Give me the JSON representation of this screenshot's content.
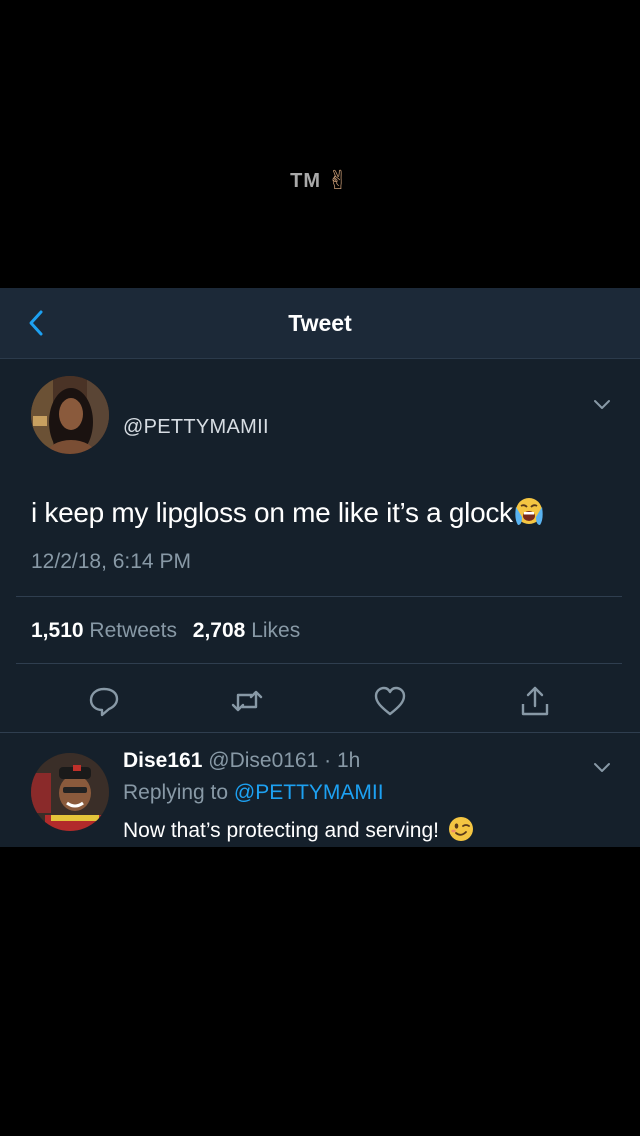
{
  "watermark": {
    "text": "TM",
    "emoji": "✌"
  },
  "navbar": {
    "title": "Tweet",
    "back_icon": "chevron-left-icon"
  },
  "tweet": {
    "handle": "@PETTYMAMII",
    "text": "i keep my lipgloss on me like it’s a glock",
    "emoji": "loudly-crying-face",
    "timestamp": "12/2/18, 6:14 PM",
    "retweets_count": "1,510",
    "retweets_label": "Retweets",
    "likes_count": "2,708",
    "likes_label": "Likes",
    "actions": [
      "reply-icon",
      "retweet-icon",
      "like-icon",
      "share-icon"
    ]
  },
  "reply": {
    "name": "Dise161",
    "meta": "@Dise0161 · 1h",
    "replying_prefix": "Replying to",
    "replying_to": "@PETTYMAMII",
    "text": "Now that’s protecting and serving!",
    "emoji": "winking-face"
  },
  "colors": {
    "background": "#000000",
    "screen": "#15202b",
    "navbar": "#1c2938",
    "accent": "#1da1f2",
    "secondary_text": "#8899a6"
  }
}
